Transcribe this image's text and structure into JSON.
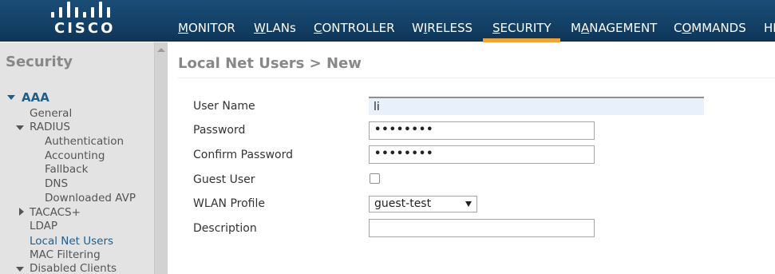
{
  "header": {
    "logo_text": "CISCO",
    "nav": [
      {
        "label": "MONITOR",
        "underline": "M",
        "rest": "ONITOR"
      },
      {
        "label": "WLANs",
        "underline": "W",
        "rest": "LANs"
      },
      {
        "label": "CONTROLLER",
        "underline": "C",
        "rest": "ONTROLLER"
      },
      {
        "label": "WIRELESS",
        "pre": "W",
        "underline": "I",
        "rest": "RELESS"
      },
      {
        "label": "SECURITY",
        "underline": "S",
        "rest": "ECURITY"
      },
      {
        "label": "MANAGEMENT",
        "pre": "M",
        "underline": "A",
        "rest": "NAGEMENT"
      },
      {
        "label": "COMMANDS",
        "pre": "C",
        "underline": "O",
        "rest": "MMANDS"
      },
      {
        "label": "HE"
      }
    ],
    "active_nav": "SECURITY",
    "accent_color": "#f0a23a"
  },
  "sidebar": {
    "title": "Security",
    "aaa": "AAA",
    "general": "General",
    "radius": "RADIUS",
    "radius_items": [
      "Authentication",
      "Accounting",
      "Fallback",
      "DNS",
      "Downloaded AVP"
    ],
    "tacacs": "TACACS+",
    "ldap": "LDAP",
    "local_net_users": "Local Net Users",
    "mac_filtering": "MAC Filtering",
    "disabled_clients": "Disabled Clients"
  },
  "main": {
    "title": "Local Net Users > New",
    "form": {
      "user_name_label": "User Name",
      "user_name_value": "li",
      "password_label": "Password",
      "password_value": "••••••••",
      "confirm_password_label": "Confirm Password",
      "confirm_password_value": "••••••••",
      "guest_user_label": "Guest User",
      "guest_user_checked": false,
      "wlan_profile_label": "WLAN Profile",
      "wlan_profile_value": "guest-test",
      "description_label": "Description",
      "description_value": ""
    }
  }
}
